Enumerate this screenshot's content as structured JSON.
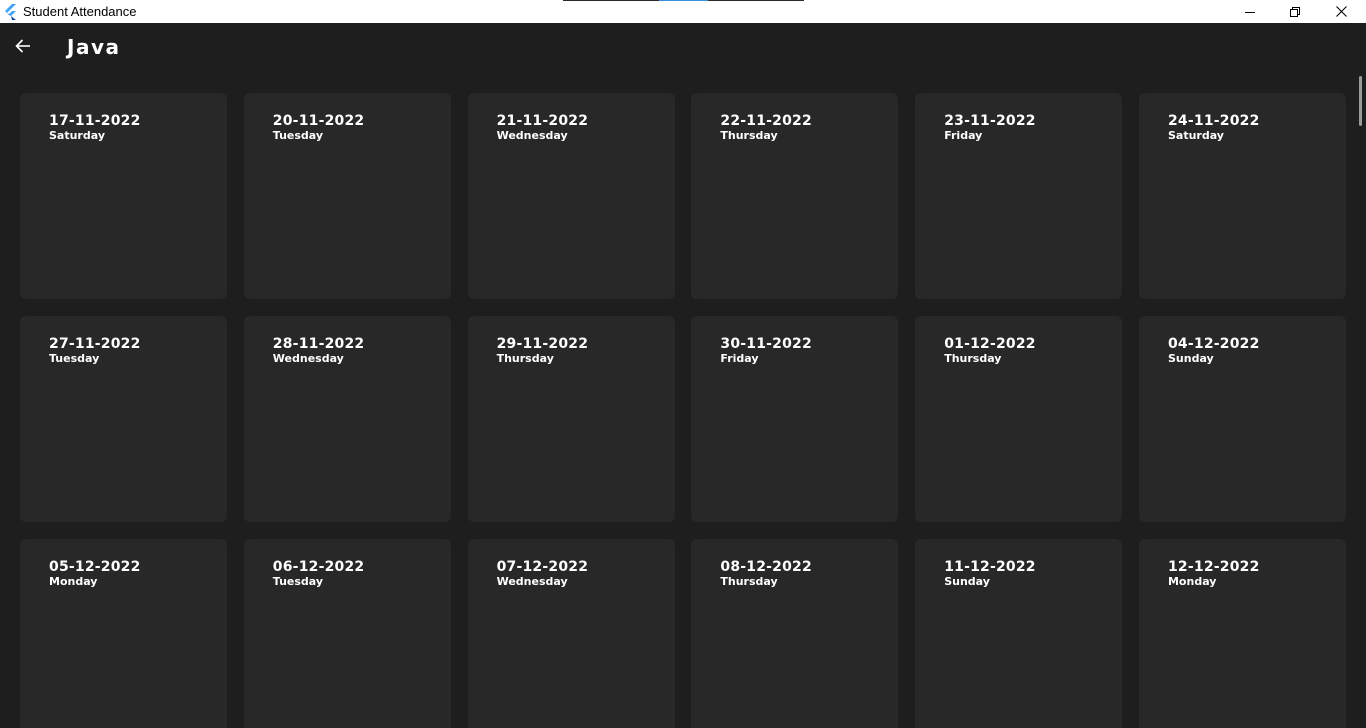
{
  "window": {
    "title": "Student Attendance"
  },
  "appbar": {
    "title": "Java"
  },
  "sessions": [
    {
      "date": "17-11-2022",
      "day": "Saturday"
    },
    {
      "date": "20-11-2022",
      "day": "Tuesday"
    },
    {
      "date": "21-11-2022",
      "day": "Wednesday"
    },
    {
      "date": "22-11-2022",
      "day": "Thursday"
    },
    {
      "date": "23-11-2022",
      "day": "Friday"
    },
    {
      "date": "24-11-2022",
      "day": "Saturday"
    },
    {
      "date": "27-11-2022",
      "day": "Tuesday"
    },
    {
      "date": "28-11-2022",
      "day": "Wednesday"
    },
    {
      "date": "29-11-2022",
      "day": "Thursday"
    },
    {
      "date": "30-11-2022",
      "day": "Friday"
    },
    {
      "date": "01-12-2022",
      "day": "Thursday"
    },
    {
      "date": "04-12-2022",
      "day": "Sunday"
    },
    {
      "date": "05-12-2022",
      "day": "Monday"
    },
    {
      "date": "06-12-2022",
      "day": "Tuesday"
    },
    {
      "date": "07-12-2022",
      "day": "Wednesday"
    },
    {
      "date": "08-12-2022",
      "day": "Thursday"
    },
    {
      "date": "11-12-2022",
      "day": "Sunday"
    },
    {
      "date": "12-12-2022",
      "day": "Monday"
    }
  ],
  "icons": {
    "app": "flutter-logo-icon",
    "back": "arrow-left-icon",
    "minimize": "minimize-icon",
    "maximize": "restore-icon",
    "close": "close-icon"
  },
  "colors": {
    "background": "#1e1e1e",
    "card": "#282828",
    "text": "#ffffff",
    "titlebar": "#ffffff"
  }
}
